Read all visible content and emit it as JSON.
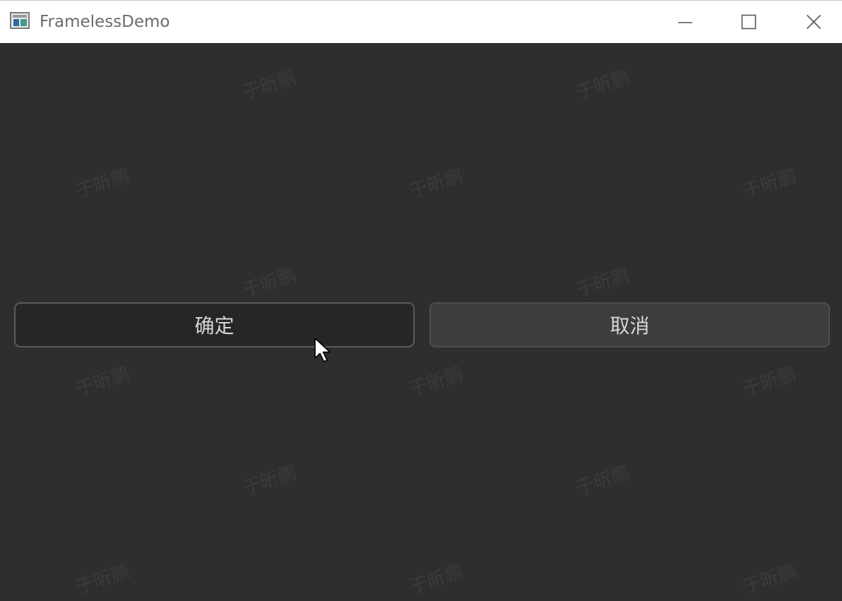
{
  "window": {
    "title": "FramelessDemo",
    "controls": {
      "minimize_icon": "minimize-icon",
      "maximize_icon": "maximize-icon",
      "close_icon": "close-icon"
    }
  },
  "buttons": {
    "ok_label": "确定",
    "cancel_label": "取消"
  },
  "watermark": {
    "text": "于昕鹏"
  },
  "colors": {
    "client_background": "#2e2e2e",
    "ok_button_background": "#262626",
    "cancel_button_background": "#3d3d3d",
    "button_text": "#d6d6d6"
  }
}
